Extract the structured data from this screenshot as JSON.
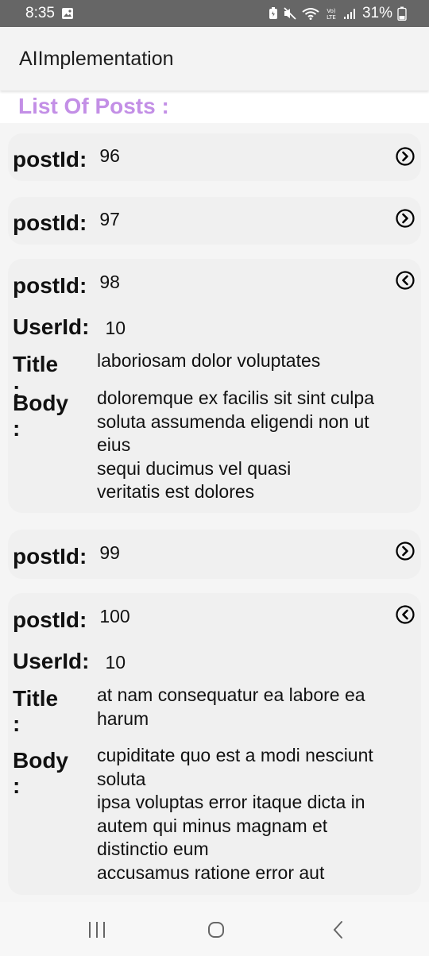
{
  "status_bar": {
    "time": "8:35",
    "battery": "31%",
    "network": "VoLTE"
  },
  "app_bar": {
    "title": "AIImplementation"
  },
  "list_title": "List Of Posts :",
  "labels": {
    "post_id": "postId:",
    "user_id": "UserId:",
    "title": "Title :",
    "body": "Body :"
  },
  "posts": [
    {
      "post_id": "96",
      "expanded": false,
      "toggle_icon": "chevron-right-circle-icon"
    },
    {
      "post_id": "97",
      "expanded": false,
      "toggle_icon": "chevron-right-circle-icon"
    },
    {
      "post_id": "98",
      "expanded": true,
      "toggle_icon": "chevron-left-circle-icon",
      "user_id": "10",
      "title": "laboriosam dolor voluptates",
      "body": "doloremque ex facilis sit sint culpa\nsoluta assumenda eligendi non ut\neius\nsequi ducimus vel quasi\nveritatis est dolores"
    },
    {
      "post_id": "99",
      "expanded": false,
      "toggle_icon": "chevron-right-circle-icon"
    },
    {
      "post_id": "100",
      "expanded": true,
      "toggle_icon": "chevron-left-circle-icon",
      "user_id": "10",
      "title": "at nam consequatur ea labore ea\nharum",
      "body": "cupiditate quo est a modi nesciunt\nsoluta\nipsa voluptas error itaque dicta in\nautem qui minus magnam et\ndistinctio eum\naccusamus ratione error aut"
    }
  ],
  "nav_bar": {
    "recents_icon": "recents-icon",
    "home_icon": "home-icon",
    "back_icon": "back-icon"
  }
}
